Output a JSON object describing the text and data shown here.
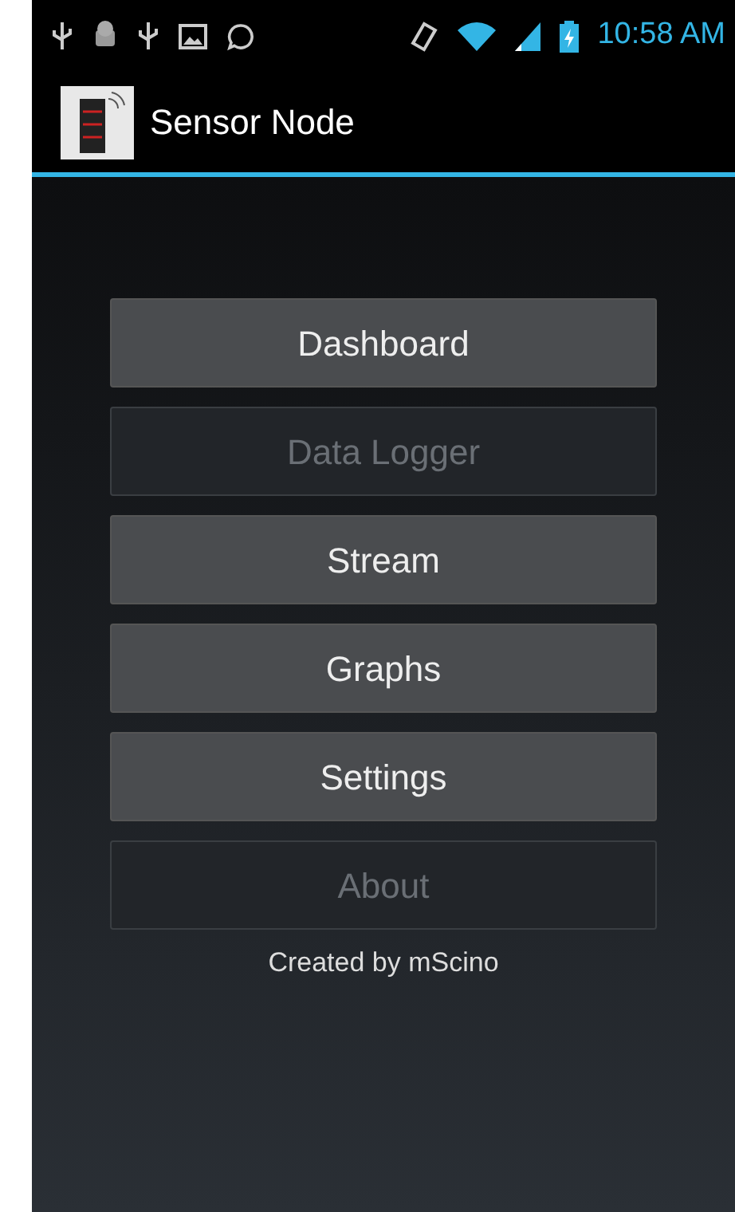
{
  "status_bar": {
    "time": "10:58 AM"
  },
  "app_bar": {
    "title": "Sensor Node"
  },
  "menu": [
    {
      "label": "Dashboard",
      "disabled": false
    },
    {
      "label": "Data Logger",
      "disabled": true
    },
    {
      "label": "Stream",
      "disabled": false
    },
    {
      "label": "Graphs",
      "disabled": false
    },
    {
      "label": "Settings",
      "disabled": false
    },
    {
      "label": "About",
      "disabled": true
    }
  ],
  "footer": {
    "text": "Created by mScino"
  }
}
